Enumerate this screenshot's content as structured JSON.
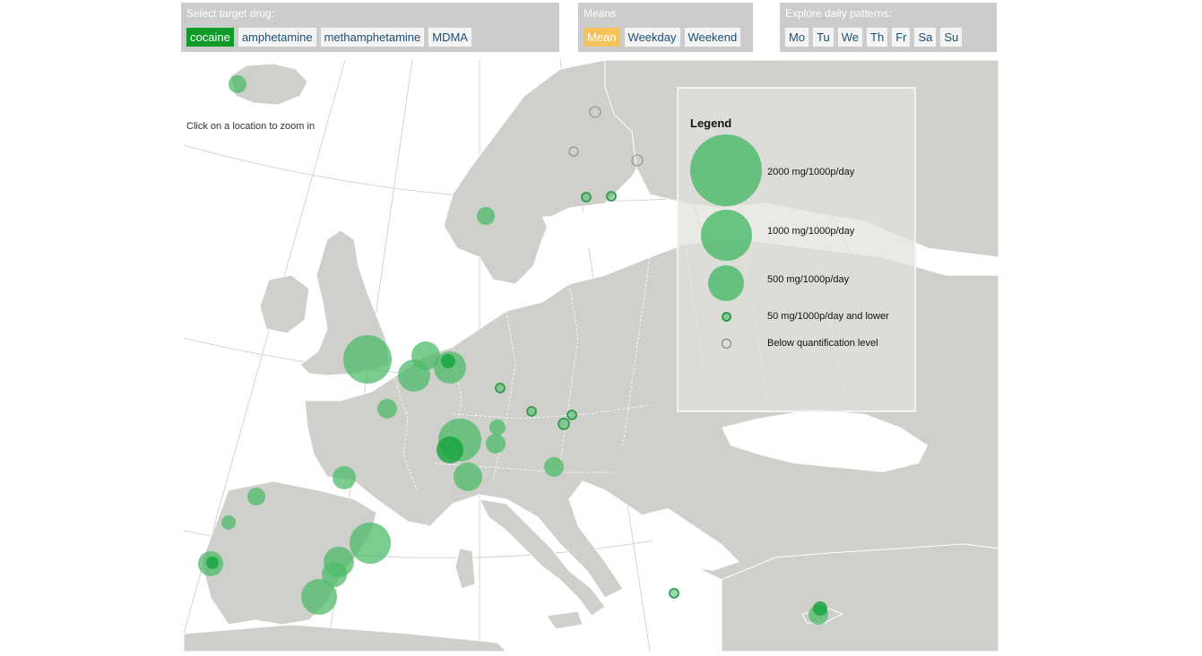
{
  "drug_selector": {
    "title": "Select target drug:",
    "options": [
      "cocaine",
      "amphetamine",
      "methamphetamine",
      "MDMA"
    ],
    "selected": "cocaine"
  },
  "means_selector": {
    "title": "Means",
    "options": [
      "Mean",
      "Weekday",
      "Weekend"
    ],
    "selected": "Mean"
  },
  "days_selector": {
    "title": "Explore daily patterns:",
    "options": [
      "Mo",
      "Tu",
      "We",
      "Th",
      "Fr",
      "Sa",
      "Su"
    ]
  },
  "map": {
    "hint": "Click on a location to zoom in",
    "colors": {
      "sea": "#ffffff",
      "land": "#cfcfcb",
      "border": "#ffffff",
      "marker": "#4dbb6a",
      "marker_dark": "#13a33b",
      "bloq": "#888888"
    }
  },
  "legend": {
    "title": "Legend",
    "items": [
      {
        "label": "2000 mg/1000p/day",
        "kind": "filled"
      },
      {
        "label": "1000 mg/1000p/day",
        "kind": "filled"
      },
      {
        "label": "500 mg/1000p/day",
        "kind": "filled"
      },
      {
        "label": "50 mg/1000p/day and lower",
        "kind": "small"
      },
      {
        "label": "Below quantification level",
        "kind": "empty"
      }
    ]
  }
}
